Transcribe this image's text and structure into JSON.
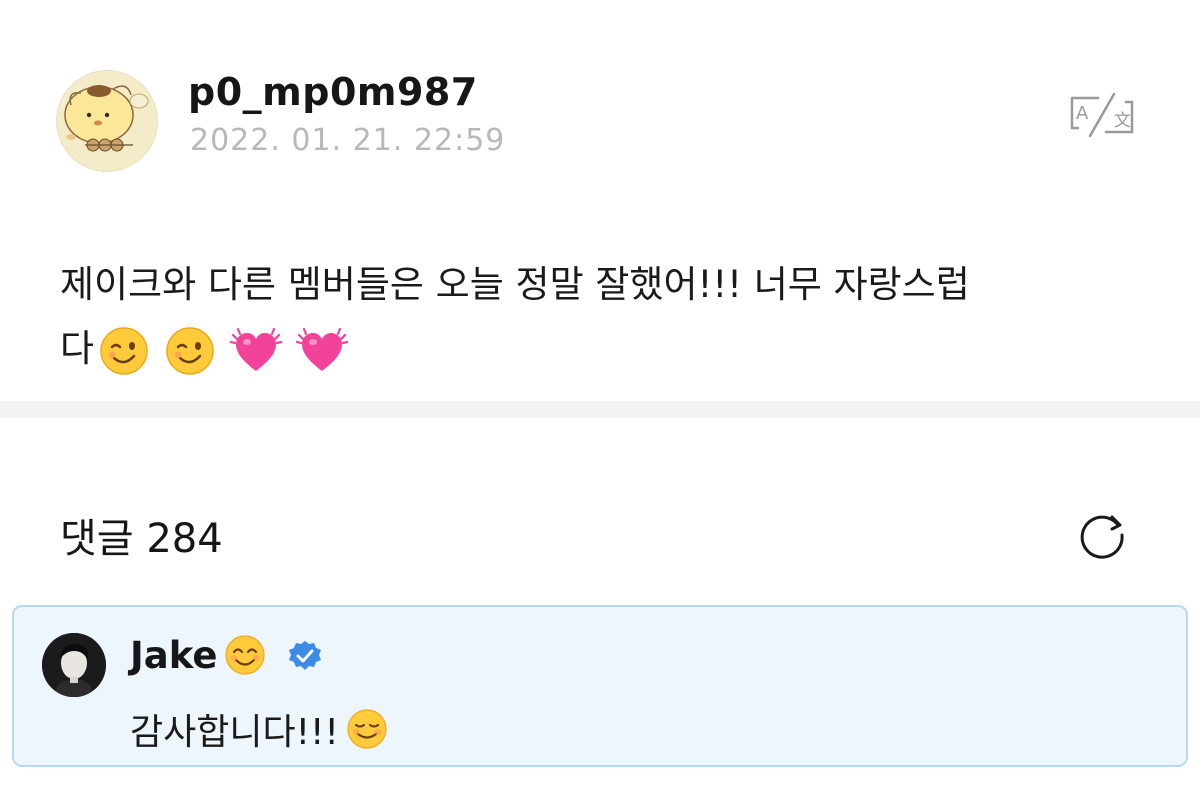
{
  "post": {
    "author": {
      "username": "p0_mp0m987",
      "avatar_icon": "pompompurin-avatar"
    },
    "timestamp": "2022. 01. 21. 22:59",
    "translate_icon": "translate-icon",
    "body": {
      "line1": "제이크와 다른 멤버들은 오늘 정말 잘했어!!! 너무 자랑스럽",
      "line2": "다",
      "emojis": [
        "winking-face",
        "winking-face",
        "beating-heart",
        "beating-heart"
      ]
    }
  },
  "comments": {
    "title": "댓글 284",
    "refresh_icon": "refresh-icon",
    "featured": {
      "author": "Jake",
      "author_emoji": "smiling-face-with-smiling-eyes",
      "verified_icon": "verified-badge-icon",
      "text": "감사합니다!!!",
      "text_emoji": "smiling-face",
      "accent_color": "#3d8be6",
      "background_color": "#edf5fd",
      "border_color": "#b9d9f3"
    }
  }
}
